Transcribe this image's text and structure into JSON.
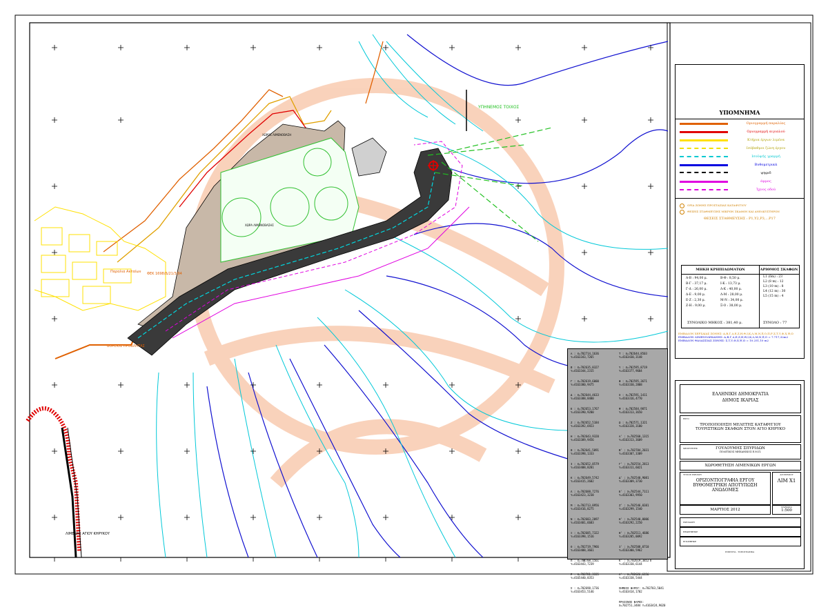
{
  "map": {
    "labels": {
      "wave_station": "ΥΠΗΝΕΜΟΣ ΤΟΙΧΟΣ",
      "port_name": "ΛΙΜΕΝΑΣ ΑΓΙΟΥ ΚΗΡΥΚΟΥ",
      "plot": "ΦΕΚ 1698/Δ/21/3/94",
      "shore_line": "Παραλια Ακταίων",
      "pier": "ΒΟΡΕΙΟΣ ΠΡΟΒΛΗΤΑΣ",
      "parking_a": "ΧΩΡΟΣ ΛΙΜΕΝΟΒΑΣΗ",
      "parking_b": "ΧΩΡΑ ΛΙΜΕΝΟΒΑΣΗΣ"
    }
  },
  "legend": {
    "title": "ΥΠΟΜΝΗΜΑ",
    "items": [
      {
        "label": "Οριογραμμή παραλίας",
        "color": "#e06000",
        "style": "solid"
      },
      {
        "label": "Οριογραμμή αιγιαλού",
        "color": "#e00000",
        "style": "solid"
      },
      {
        "label": "Κτήρια έργων λιμένα",
        "color": "#ffe000",
        "style": "solid"
      },
      {
        "label": "Ισόβαθμοι ζώνη έργου",
        "color": "#f0e000",
        "style": "dash"
      },
      {
        "label": "Ισοϋψής γραμμή",
        "color": "#00c8d0",
        "style": "dash"
      },
      {
        "label": "Βυθομετρικά",
        "color": "#0000e0",
        "style": "solid"
      },
      {
        "label": "ψηφιδ",
        "color": "#000000",
        "style": "tick"
      },
      {
        "label": "άμμος",
        "color": "#e000e0",
        "style": "solid"
      },
      {
        "label": "Ίχνος οδού",
        "color": "#e000e0",
        "style": "dash"
      }
    ],
    "notes": [
      "ΟΡΙΑ ΖΩΝΗΣ ΠΡΟΣΤΑΣΙΑΣ ΚΑΤΑΦΥΓΙΟΥ",
      "ΘΕΣΕΙΣ ΣΤΑΘΜΕΥΣΗΣ ΜΙΚΡΩΝ ΣΚΑΦΩΝ ΚΑΙ ΑΝΕΛΚΥΣΤΗΡΩΝ"
    ],
    "stations_label": "ΘΕΣΕΙΣ ΣΤΑΘΜΕΥΣΗΣ : P1,Y2,P3,...P17"
  },
  "lengths_table": {
    "header_left": "ΜΗΚΗ ΚΡΗΠΙΔΩΜΑΤΩΝ",
    "header_right": "ΑΡΙΘΜΟΣ ΣΚΑΦΩΝ",
    "rows": [
      "Α-Β : 94,00 μ.",
      "Β-Θ : 8,50 μ.",
      "Β-Γ : 37,17 μ.",
      "Ι-Κ : 13,73 μ.",
      "Γ-Δ : 26,00 μ.",
      "Λ-Κ : 40,00 μ.",
      "Δ-Ε : 9,00 μ.",
      "Λ-Μ : 28,00 μ.",
      "Ε-Ζ : 2,30 μ.",
      "Μ-Ν : 34,00 μ.",
      "Ζ-Η : 9,00 μ.",
      "Ξ-Ο : 38,00 μ."
    ],
    "boats": [
      "L1 (6m) : 23",
      "L2 (8 m) : 12",
      "L3 (10 m) : 8",
      "L4 (12 m) : 30",
      "L5 (15 m) : 4"
    ],
    "total_length": "ΣΥΝΟΛΙΚΟ ΜΗΚΟΣ : 381,40 μ.",
    "total_boats": "ΣΥΝΟΛΟ : 77"
  },
  "ref_lines": {
    "orange": "ΕΜΒΑΔΟΝ ΧΕΡΣΑΙΑΣ ΖΩΝΗΣ: Α,Β,Γ,Δ,Ε,Ζ,Η,Θ,Ι,Κ,Λ,Μ,Ν,Ξ,Ο,Π,Ρ,Σ,Τ,Υ,Φ,Χ,Ψ,Ω",
    "blue1": "ΕΜΒΑΔΟΝ ΛΙΜΕΝΟΛΕΚΑΝΗΣ: Α,Β,Γ,Δ,Ε,Ζ,Η,Θ,Ι,Κ,Λ,Μ,Ν,Ξ,Ο = 7.717,32m2",
    "blue2": "ΕΜΒΑΔΟΝ ΘΑΛΑΣΣΙΑΣ ΖΩΝΗΣ: Σ,Τ,Υ,Φ,Χ,Ψ,Ω = 10.251,10 m2"
  },
  "coordinates": {
    "col1": [
      "Α : Χ=702714,1636 Υ=4163343,7265",
      "Β : Χ=702635,8327 Υ=4163344,2315",
      "Γ : Χ=702619,6000 Υ=4163380,9475",
      "Δ : Χ=702644,4633 Υ=4163388,8480",
      "Ε : Χ=702653,1767 Υ=4163390,9200",
      "Ζ : Χ=702652,5184 Υ=4163392,6923",
      "Η : Χ=702643,9320 Υ=4163389,9456",
      "Θ : Χ=702641,5891 Υ=4163398,1333",
      "Ι : Χ=702652,8579 Υ=4163408,8281",
      "Κ : Χ=702649,5742 Υ=4163415,2602",
      "Λ : Χ=702688,7276 Υ=4163423,3238",
      "Μ : Χ=702713,8956 Υ=4163416,8275",
      "Ν : Χ=702683,2097 Υ=4163401,6683",
      "Ξ : Χ=702685,7322 Υ=4163398,1516",
      "Ο : Χ=702719,7966 Υ=4163408,3661",
      "Π : Χ=702708,1561 Υ=4163443,7239",
      "Ρ : Χ=702781,3335 Υ=4165440,8353",
      "Σ : Χ=702698,1736 Υ=4163453,5146"
    ],
    "col2": [
      "Τ : Χ=702644,8503 Υ=4163430,3148",
      "Υ : Χ=702595,8719 Υ=4163377,9604",
      "Φ : Χ=702595,3671 Υ=4163330,2808",
      "Χ : Χ=702591,1411 Υ=4163316,4770",
      "Ψ : Χ=702584,9871 Υ=4163313,3650",
      "Ω : Χ=702571,1321 Υ=4163328,3100",
      "Α' : Χ=702560,1315 Υ=4163313,3609",
      "Β' : Χ=702784,2031 Υ=4163307,3309",
      "Γ' : Χ=702554,2813 Υ=4163311,6021",
      "Δ' : Χ=702540,9081 Υ=4163309,3730",
      "Ε' : Χ=702544,7111 Υ=4163303,9950",
      "Ζ' : Χ=702546,0381 Υ=4163299,1540",
      "Η' : Χ=702540,0006 Υ=4163292,2250",
      "Θ' : Χ=702511,4686 Υ=4163285,0092",
      "Ι' : Χ=702508,0710 Υ=4163300,5962",
      "Κ' : Χ=702619,3852 Υ=4163330,6144",
      "Λ' : Χ=702626,6156 Υ=4163338,5444",
      "ΣΗΜΕΙΟ ΦΑΡΟΥ: Χ=702703,5041 Υ=4163414,1702",
      "ΠΡΑΣΙΝΟΣ ΦΑΡΟΣ: Χ=702751,3484 Υ=4163424,9020"
    ]
  },
  "title_block": {
    "state": "ΕΛΛΗΝΙΚΗ ΔΗΜΟΚΡΑΤΙΑ",
    "municipality": "ΔΗΜΟΣ ΙΚΑΡΙΑΣ",
    "project_label": "ΕΡΓΟ",
    "project": "ΤΡΟΠΟΠΟΙΗΣΗ ΜΕΛΕΤΗΣ ΚΑΤΑΦΥΓΙΟΥ ΤΟΥΡΙΣΤΙΚΩΝ ΣΚΑΦΩΝ ΣΤΟΝ ΑΓΙΟ ΚΗΡΥΚΟ",
    "designer_label": "ΜΕΛΕΤΗΤΗΣ",
    "designer": "ΓΟΥΛΟΥΜΗΣ ΣΠΥΡΙΔΩΝ",
    "designer_role": "ΠΟΛΙΤΙΚΟΣ ΜΗΧΑΝΙΚΟΣ Ε.Μ.Π.",
    "category": "ΧΩΡΟΘΕΤΗΣΗ ΛΙΜΕΝΙΚΩΝ ΕΡΓΩΝ",
    "drawing_label": "ΤΙΤΛΟΣ ΣΧΕΔΙΟΥ",
    "drawing_title": "ΟΡΙΖΟΝΤΙΟΓΡΑΦΙΑ ΕΡΓΟΥ ΒΥΘΟΜΕΤΡΙΚΗ ΑΠΟΤΥΠΩΣΗ ΑΝΩΔΟΜΕΣ",
    "number_label": "ΑΡ.ΣΧΕΔΙΟΥ",
    "drawing_number": "ΛΙΜ Χ1",
    "date": "ΜΑΡΤΙΟΣ 2012",
    "scale_label": "ΚΛΙΜΑΚΑ",
    "scale": "1:500",
    "row1": "ΣΧΕΔΙΑΣΗ",
    "row2": "ΘΕΩΡΗΘΗΚΕ",
    "row3": "ΕΓΚΡΙΘΗΚΕ",
    "footer": "ΙΝΦΙΝΙΤΑ - ΤΟΠΟΓΡΑΦΙΚΑ"
  }
}
